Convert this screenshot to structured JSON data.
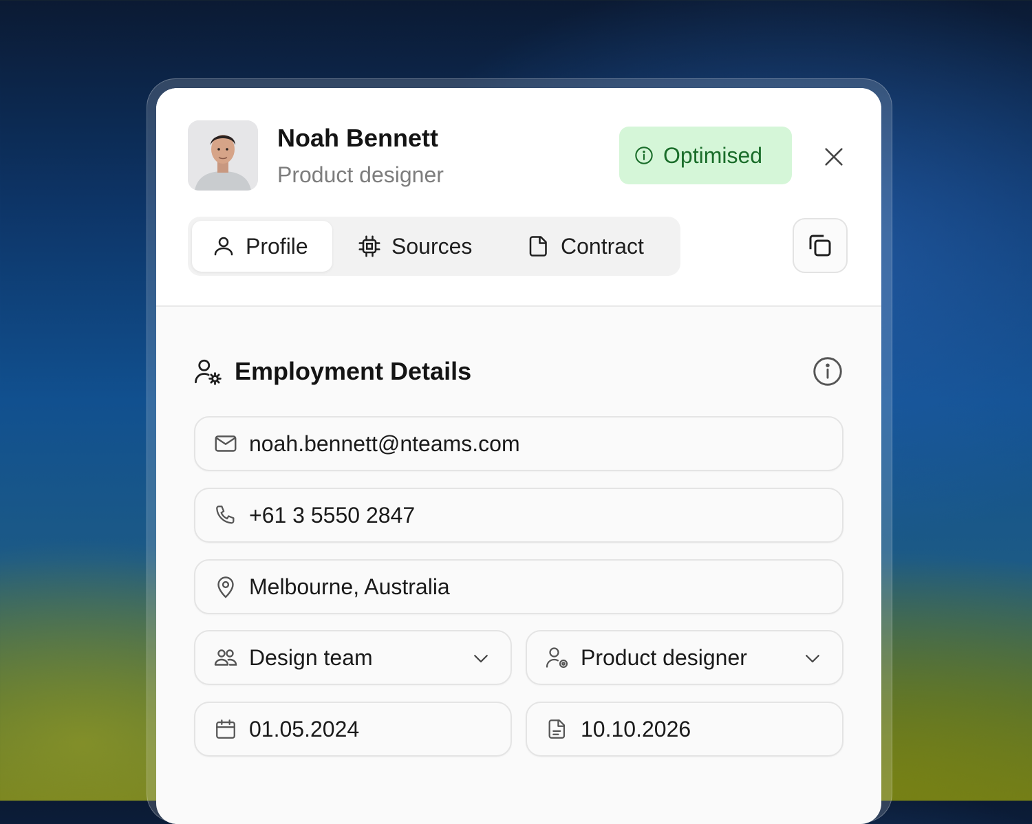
{
  "profile": {
    "name": "Noah Bennett",
    "title": "Product designer",
    "status_badge": "Optimised"
  },
  "tabs": [
    {
      "label": "Profile",
      "icon": "user-icon",
      "active": true
    },
    {
      "label": "Sources",
      "icon": "chip-icon",
      "active": false
    },
    {
      "label": "Contract",
      "icon": "document-icon",
      "active": false
    }
  ],
  "section": {
    "title": "Employment Details"
  },
  "fields": {
    "email": "noah.bennett@nteams.com",
    "phone": "+61 3 5550 2847",
    "location": "Melbourne, Australia",
    "team": "Design team",
    "role": "Product designer",
    "start_date": "01.05.2024",
    "end_date": "10.10.2026"
  },
  "colors": {
    "badge_bg": "#d5f6d8",
    "badge_text": "#1a6d2a",
    "card_bg": "#fafafa"
  }
}
